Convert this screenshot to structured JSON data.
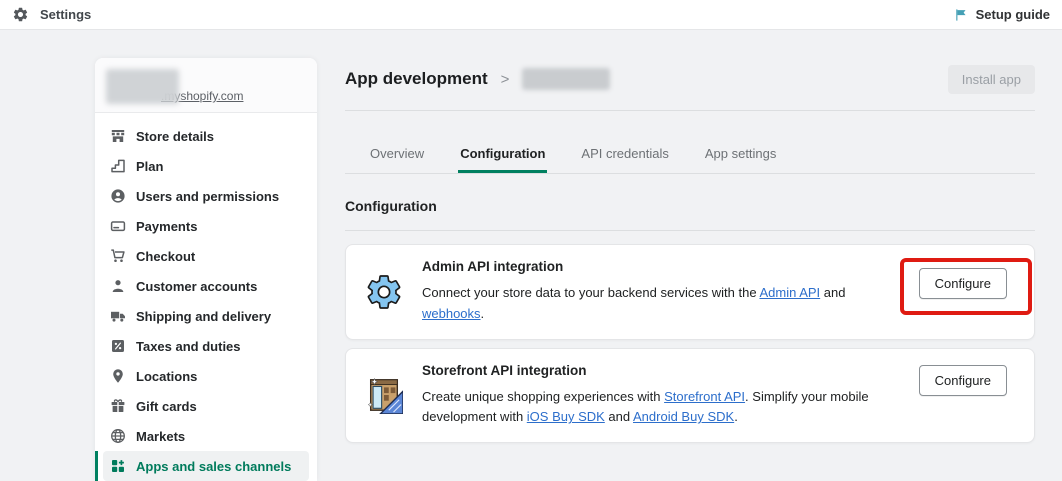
{
  "topbar": {
    "title": "Settings",
    "title_icon": "settings-gear-icon",
    "setup_guide_label": "Setup guide",
    "setup_guide_icon": "setup-guide-flag-icon"
  },
  "sidebar": {
    "store_domain_suffix": ".myshopify.com",
    "items": [
      {
        "label": "Store details",
        "icon": "store-icon",
        "active": false
      },
      {
        "label": "Plan",
        "icon": "plan-stairs-icon",
        "active": false
      },
      {
        "label": "Users and permissions",
        "icon": "users-icon",
        "active": false
      },
      {
        "label": "Payments",
        "icon": "payments-card-icon",
        "active": false
      },
      {
        "label": "Checkout",
        "icon": "checkout-cart-icon",
        "active": false
      },
      {
        "label": "Customer accounts",
        "icon": "customer-person-icon",
        "active": false
      },
      {
        "label": "Shipping and delivery",
        "icon": "shipping-truck-icon",
        "active": false
      },
      {
        "label": "Taxes and duties",
        "icon": "taxes-percent-icon",
        "active": false
      },
      {
        "label": "Locations",
        "icon": "locations-pin-icon",
        "active": false
      },
      {
        "label": "Gift cards",
        "icon": "gift-icon",
        "active": false
      },
      {
        "label": "Markets",
        "icon": "markets-globe-icon",
        "active": false
      },
      {
        "label": "Apps and sales channels",
        "icon": "apps-grid-plus-icon",
        "active": true
      }
    ]
  },
  "main": {
    "breadcrumb_root": "App development",
    "breadcrumb_separator": ">",
    "install_button_label": "Install app",
    "tabs": [
      {
        "label": "Overview",
        "active": false
      },
      {
        "label": "Configuration",
        "active": true
      },
      {
        "label": "API credentials",
        "active": false
      },
      {
        "label": "App settings",
        "active": false
      }
    ],
    "section_title": "Configuration",
    "cards": [
      {
        "icon": "admin-api-gear-icon",
        "title": "Admin API integration",
        "description": [
          {
            "text": "Connect your store data to your backend services with the ",
            "link": false
          },
          {
            "text": "Admin API",
            "link": true
          },
          {
            "text": " and ",
            "link": false
          },
          {
            "text": "webhooks",
            "link": true
          },
          {
            "text": ".",
            "link": false
          }
        ],
        "button_label": "Configure",
        "highlighted": true
      },
      {
        "icon": "storefront-pixel-icon",
        "title": "Storefront API integration",
        "description": [
          {
            "text": "Create unique shopping experiences with ",
            "link": false
          },
          {
            "text": "Storefront API",
            "link": true
          },
          {
            "text": ". Simplify your mobile development with ",
            "link": false
          },
          {
            "text": "iOS Buy SDK",
            "link": true
          },
          {
            "text": " and ",
            "link": false
          },
          {
            "text": "Android Buy SDK",
            "link": true
          },
          {
            "text": ".",
            "link": false
          }
        ],
        "button_label": "Configure",
        "highlighted": false
      }
    ]
  },
  "colors": {
    "accent_green": "#008060",
    "active_text_green": "#007b5c",
    "link_blue": "#2c6ecb",
    "annotation_red": "#df1b12",
    "setup_guide_teal": "#45a0b5",
    "page_background": "#f1f2f4"
  }
}
